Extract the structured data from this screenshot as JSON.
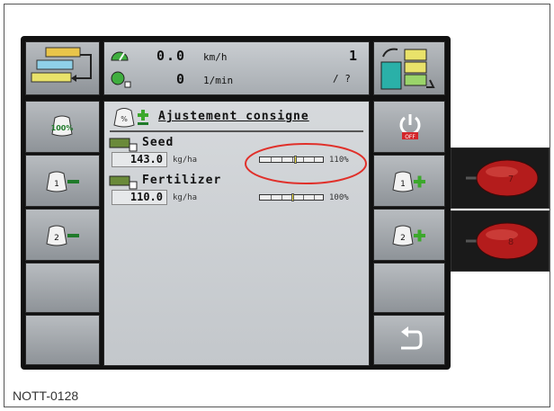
{
  "header": {
    "speed_value": "0.0",
    "speed_unit": "km/h",
    "rpm_value": "0",
    "rpm_unit": "1/min",
    "section_count": "1",
    "section_fraction": "/ ?"
  },
  "panel": {
    "title": "Ajustement consigne"
  },
  "products": [
    {
      "name": "Seed",
      "value": "143.0",
      "unit": "kg/ha",
      "percent": "110%",
      "level": 1.1
    },
    {
      "name": "Fertilizer",
      "value": "110.0",
      "unit": "kg/ha",
      "percent": "100%",
      "level": 1.0
    }
  ],
  "left_buttons": [
    {
      "icon": "bag-100-percent-icon",
      "label": "100%"
    },
    {
      "icon": "bag-1-minus-icon",
      "label": "1"
    },
    {
      "icon": "bag-2-minus-icon",
      "label": "2"
    }
  ],
  "right_buttons": [
    {
      "icon": "power-off-icon",
      "label": "OFF"
    },
    {
      "icon": "bag-1-plus-icon",
      "label": "1"
    },
    {
      "icon": "bag-2-plus-icon",
      "label": "2"
    },
    {
      "icon": "back-arrow-icon"
    }
  ],
  "side_keys": [
    {
      "label": "7"
    },
    {
      "label": "8"
    }
  ],
  "caption": "NOTT-0128",
  "colors": {
    "highlight": "#e0302a",
    "terminal": "#111111",
    "key": "#b41c1c",
    "plus": "#3ca82c",
    "minus": "#1f7a2a"
  }
}
